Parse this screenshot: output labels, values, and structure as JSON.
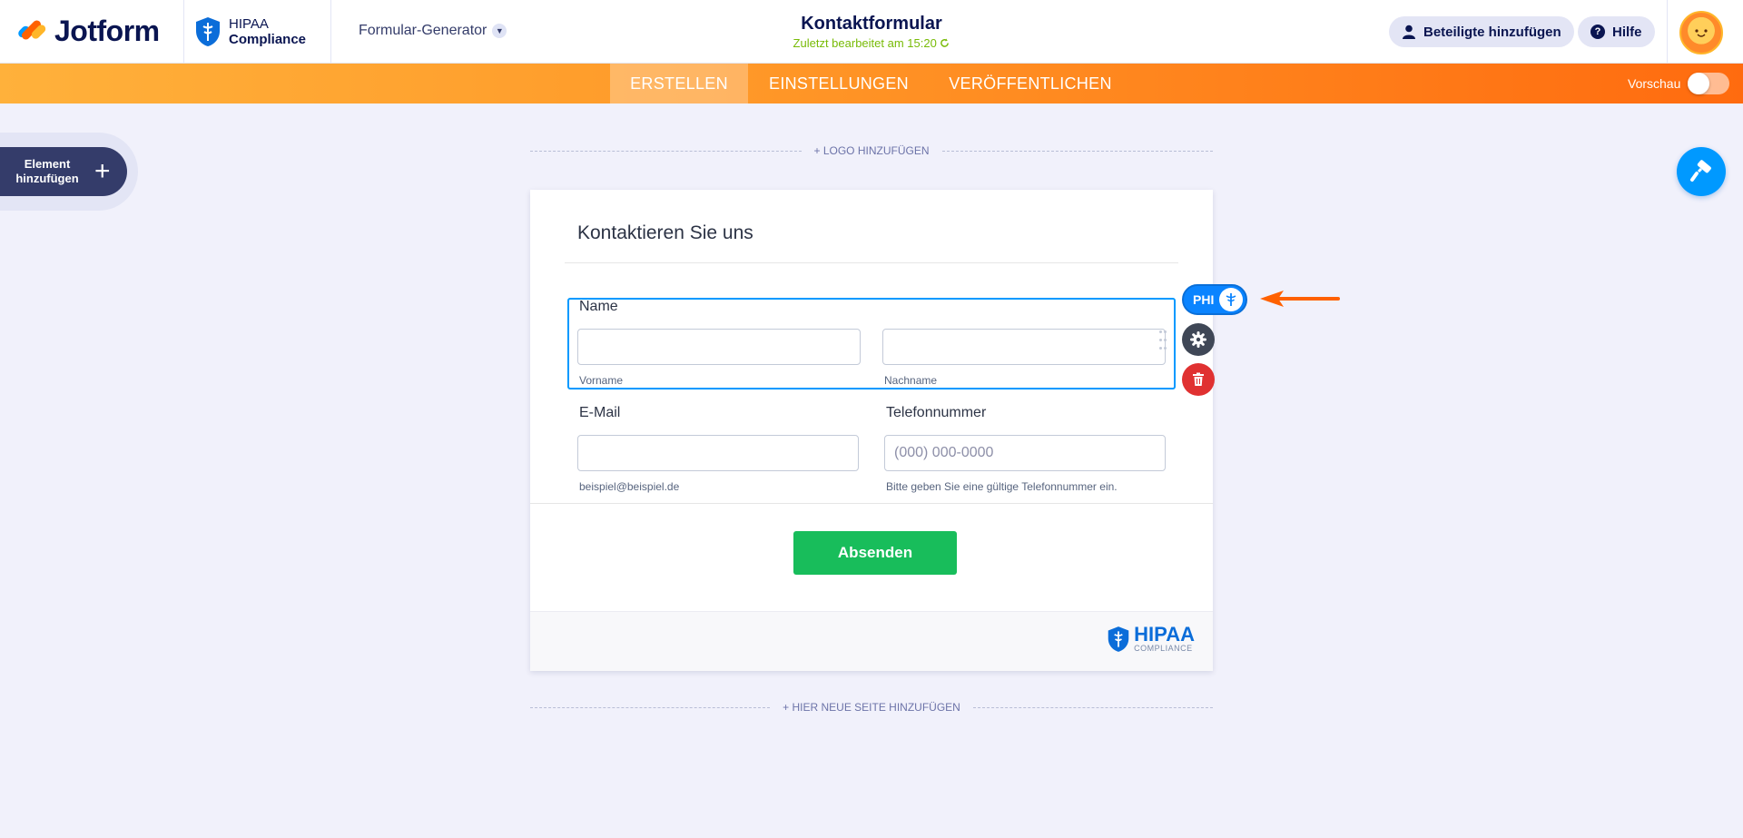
{
  "header": {
    "logo_text": "Jotform",
    "hipaa_line1": "HIPAA",
    "hipaa_line2": "Compliance",
    "builder_menu": "Formular-Generator",
    "form_title": "Kontaktformular",
    "last_edited": "Zuletzt bearbeitet am 15:20",
    "add_participants": "Beteiligte hinzufügen",
    "help": "Hilfe"
  },
  "tabs": {
    "build": "ERSTELLEN",
    "settings": "EINSTELLUNGEN",
    "publish": "VERÖFFENTLICHEN",
    "preview_label": "Vorschau",
    "preview_on": false
  },
  "sidebar": {
    "add_element_line1": "Element",
    "add_element_line2": "hinzufügen",
    "plus": "+"
  },
  "canvas": {
    "add_logo": "+ LOGO HINZUFÜGEN",
    "add_page": "+ HIER NEUE SEITE HINZUFÜGEN"
  },
  "form": {
    "heading": "Kontaktieren Sie uns",
    "name_label": "Name",
    "first_name_value": "",
    "first_name_sub": "Vorname",
    "last_name_value": "",
    "last_name_sub": "Nachname",
    "email_label": "E-Mail",
    "email_value": "",
    "email_sub": "beispiel@beispiel.de",
    "phone_label": "Telefonnummer",
    "phone_value": "",
    "phone_placeholder": "(000) 000-0000",
    "phone_sub": "Bitte geben Sie eine gültige Telefonnummer ein.",
    "submit": "Absenden",
    "footer_badge_big": "HIPAA",
    "footer_badge_small": "COMPLIANCE"
  },
  "field_tools": {
    "phi_label": "PHI"
  },
  "colors": {
    "accent_orange": "#ff6100",
    "accent_blue": "#0099ff",
    "submit_green": "#18bd5b",
    "delete_red": "#e03131",
    "navy": "#0a1551"
  }
}
